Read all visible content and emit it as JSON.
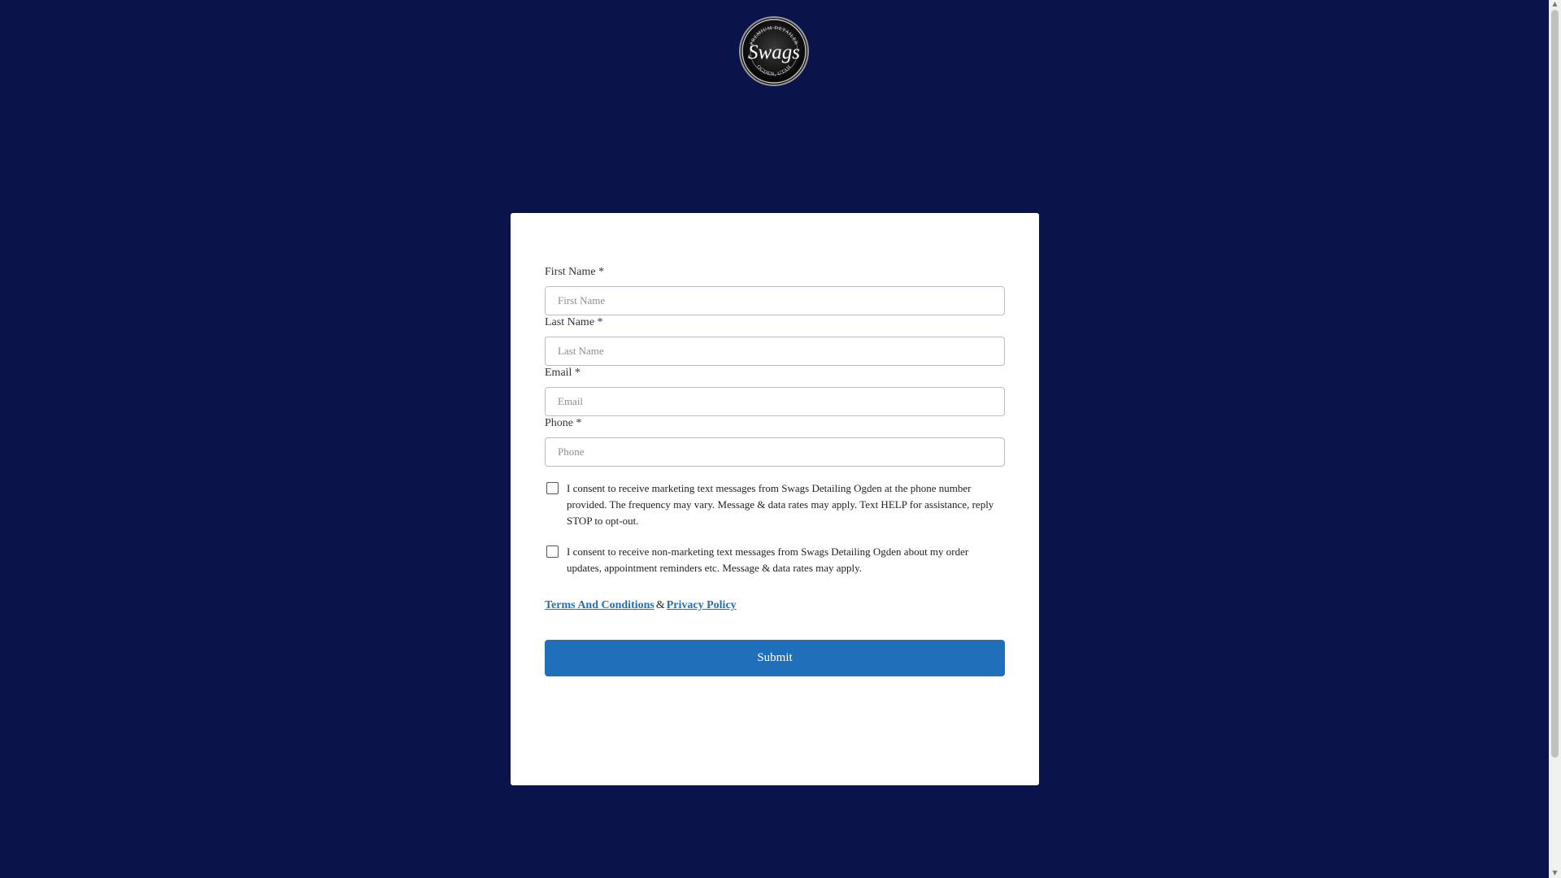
{
  "brand": {
    "logo_top_text": "PREMIUM DETAILER",
    "logo_main_text": "Swags",
    "logo_bottom_text": "OGDEN, UTAH"
  },
  "colors": {
    "background": "#0b144a",
    "button": "#1f6fba",
    "link": "#1f6fb5"
  },
  "form": {
    "first_name": {
      "label": "First Name *",
      "placeholder": "First Name"
    },
    "last_name": {
      "label": "Last Name *",
      "placeholder": "Last Name"
    },
    "email": {
      "label": "Email *",
      "placeholder": "Email"
    },
    "phone": {
      "label": "Phone *",
      "placeholder": "Phone"
    },
    "consent_marketing": {
      "checked": false,
      "text": "I consent to receive marketing text messages from Swags Detailing Ogden at the phone number provided. The frequency may vary. Message & data rates may apply. Text HELP for assistance, reply STOP to opt-out."
    },
    "consent_nonmarketing": {
      "checked": false,
      "text": "I consent to receive non-marketing text messages from Swags Detailing Ogden about my order updates, appointment reminders etc. Message & data rates may apply."
    },
    "terms_link": "Terms And Conditions",
    "ampersand": "&",
    "privacy_link": "Privacy Policy",
    "submit_label": "Submit"
  }
}
